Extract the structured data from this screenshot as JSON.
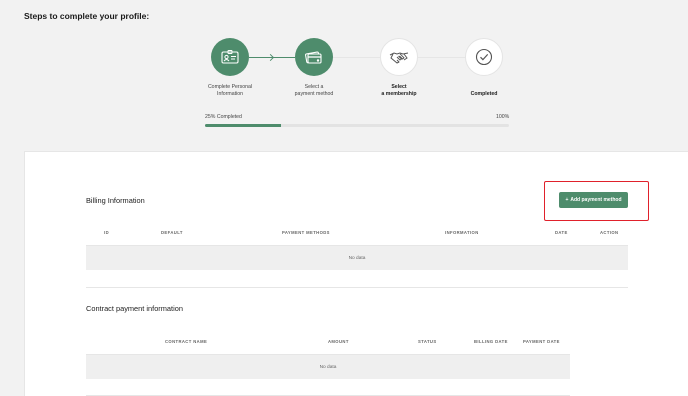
{
  "page_title": "Steps to complete your profile:",
  "steps": [
    {
      "label_line1": "Complete Personal",
      "label_line2": "Information",
      "status": "done",
      "icon": "id-card-icon"
    },
    {
      "label_line1": "Select a",
      "label_line2": "payment method",
      "status": "done",
      "icon": "credit-card-icon"
    },
    {
      "label_line1": "Select",
      "label_line2": "a membership",
      "status": "current",
      "icon": "handshake-icon"
    },
    {
      "label_line1": "Completed",
      "label_line2": "",
      "status": "todo",
      "icon": "check-circle-icon"
    }
  ],
  "progress": {
    "label": "25% Completed",
    "max_label": "100%",
    "value": 0.25
  },
  "billing": {
    "title": "Billing Information",
    "add_button": "Add payment method",
    "columns": [
      "ID",
      "DEFAULT",
      "PAYMENT METHODS",
      "INFORMATION",
      "DATE",
      "ACTION"
    ],
    "empty_text": "No data"
  },
  "contract": {
    "title": "Contract payment information",
    "columns": [
      "CONTRACT NAME",
      "AMOUNT",
      "STATUS",
      "BILLING DATE",
      "PAYMENT DATE"
    ],
    "empty_text": "No data"
  },
  "colors": {
    "accent": "#4e8c6c",
    "highlight": "#e0212b"
  }
}
